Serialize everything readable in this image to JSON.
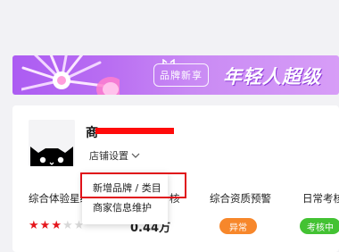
{
  "banner": {
    "badge_text": "品牌新享",
    "slogan": "年轻人超级",
    "colors": {
      "start": "#ac5cf2",
      "end": "#d79df7"
    }
  },
  "shop": {
    "name": "商",
    "settings_label": "店铺设置"
  },
  "metrics": [
    {
      "label": "综合体验星级"
    },
    {
      "label": "核"
    },
    {
      "label": "综合资质预警"
    },
    {
      "label": "日常考核"
    }
  ],
  "rating": {
    "stars_filled": 3,
    "stars_total": 5,
    "value": "0.44万"
  },
  "status": {
    "warning_badge": "异常",
    "review_badge": "考核中",
    "colors": {
      "warning": "#f7872b",
      "review": "#43c233"
    }
  },
  "dropdown": {
    "items": [
      "新增品牌 / 类目",
      "商家信息维护"
    ]
  }
}
